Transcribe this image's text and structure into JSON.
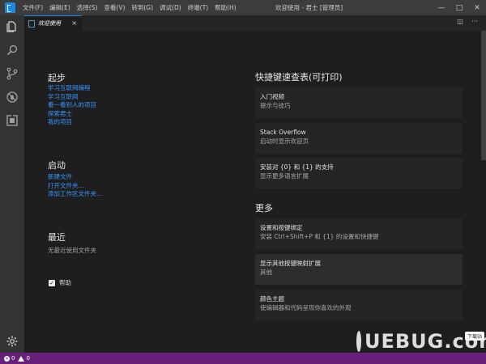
{
  "titlebar": {
    "menu": [
      "文件(F)",
      "编辑(E)",
      "选择(S)",
      "查看(V)",
      "转到(G)",
      "调试(D)",
      "终端(T)",
      "帮助(H)"
    ],
    "window_title": "欢迎使用 - 君士 [管理员]",
    "minimize": "—",
    "maximize": "□",
    "close": "✕"
  },
  "activity_bar": {
    "icons": [
      "files-icon",
      "search-icon",
      "source-control-icon",
      "debug-icon",
      "extensions-icon"
    ],
    "settings_icon": "gear-icon"
  },
  "tabs": {
    "active_label": "欢迎使用",
    "close_glyph": "×",
    "split_glyph": "◫",
    "more_glyph": "···"
  },
  "welcome": {
    "start": {
      "heading": "起步",
      "links": [
        "学习互联网编程",
        "学习互联网",
        "看一看别人的项目",
        "探索君士",
        "我的项目"
      ]
    },
    "launch": {
      "heading": "启动",
      "links": [
        "新建文件",
        "打开文件夹...",
        "添加工作区文件夹..."
      ]
    },
    "recent": {
      "heading": "最近",
      "empty_text": "无最近使用文件夹"
    },
    "help_checkbox": {
      "label": "帮助",
      "checked": true,
      "glyph": "✓"
    },
    "shortcuts": {
      "heading": "快捷键速查表(可打印)",
      "cards": [
        {
          "title": "入门视频",
          "desc": "提示与技巧"
        },
        {
          "title": "Stack Overflow",
          "desc": "启动时显示欢迎页"
        },
        {
          "title": "安装对 {0} 和 {1} 的支持",
          "desc": "显示更多语言扩展"
        }
      ]
    },
    "more": {
      "heading": "更多",
      "cards": [
        {
          "title": "设置和按键绑定",
          "desc": "安装 Ctrl+Shift+P 和 {1} 的设置和快捷键"
        },
        {
          "title": "显示其他按键映射扩展",
          "desc": "其他"
        },
        {
          "title": "颜色主题",
          "desc": "使编辑器和代码呈现你喜欢的外观"
        }
      ]
    }
  },
  "statusbar": {
    "errors": "0",
    "warnings": "0"
  },
  "watermark": {
    "text": "UEBUG.com",
    "badge": "下载站"
  },
  "colors": {
    "accent": "#1e88e5",
    "link": "#3794ff",
    "statusbar": "#68217a",
    "background": "#1e1e1e"
  }
}
